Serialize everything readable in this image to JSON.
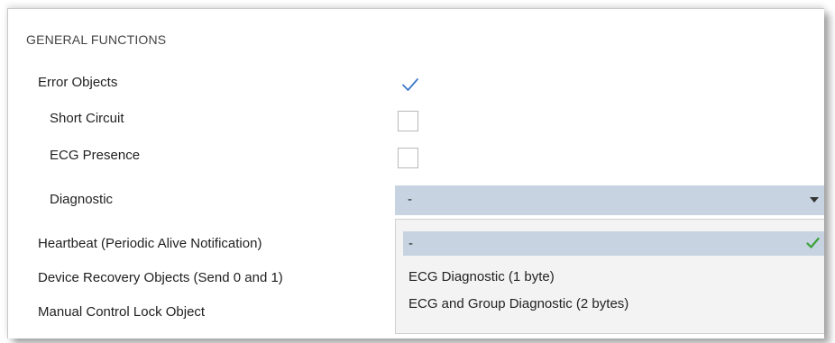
{
  "section": {
    "title": "GENERAL FUNCTIONS"
  },
  "rows": {
    "error_objects": {
      "label": "Error Objects",
      "checked": true
    },
    "short_circuit": {
      "label": "Short Circuit",
      "checked": false
    },
    "ecg_presence": {
      "label": "ECG Presence",
      "checked": false
    },
    "diagnostic": {
      "label": "Diagnostic"
    },
    "heartbeat": {
      "label": "Heartbeat (Periodic Alive Notification)"
    },
    "device_recovery": {
      "label": "Device Recovery Objects (Send 0 and 1)"
    },
    "manual_lock": {
      "label": "Manual Control Lock Object"
    }
  },
  "diagnostic_select": {
    "value": "-",
    "options": [
      {
        "label": "-",
        "selected": true
      },
      {
        "label": "ECG Diagnostic (1 byte)",
        "selected": false
      },
      {
        "label": "ECG and Group Diagnostic (2 bytes)",
        "selected": false
      }
    ]
  },
  "colors": {
    "select_bg": "#c7d3e0",
    "check_blue": "#3c78c8",
    "check_green": "#3aa23a",
    "dropdown_bg": "#f3f3f3"
  },
  "icons": {
    "error_objects_check": "checkmark-icon",
    "selected_option_check": "check-icon",
    "select_arrow": "chevron-down-icon"
  }
}
